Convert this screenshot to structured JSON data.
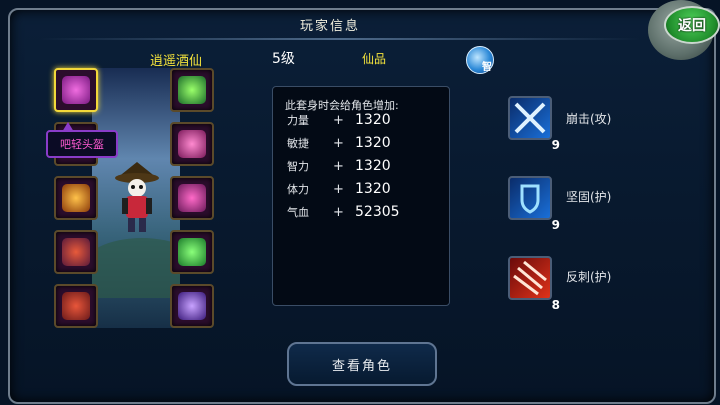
{
  "title": "玩家信息",
  "return_label": "返回",
  "character": {
    "name": "逍遥酒仙",
    "level": "5级",
    "rank": "仙品",
    "badge": "智"
  },
  "equipment_tooltip": "吧轻头盔",
  "equipment_slots_left": [
    {
      "icon": "helmet-icon",
      "color": "#b23ab5",
      "selected": true
    },
    {
      "icon": "necklace-icon",
      "color": "#6f2a7c",
      "selected": false
    },
    {
      "icon": "weapon-icon",
      "color": "#c9731a",
      "selected": false
    },
    {
      "icon": "armor-icon",
      "color": "#c73030",
      "selected": false
    },
    {
      "icon": "boots-icon",
      "color": "#c0321e",
      "selected": false
    }
  ],
  "equipment_slots_right": [
    {
      "icon": "amulet-icon",
      "color": "#2e8a3b",
      "selected": false
    },
    {
      "icon": "ring-icon",
      "color": "#d0398f",
      "selected": false
    },
    {
      "icon": "cape-icon",
      "color": "#c23aa0",
      "selected": false
    },
    {
      "icon": "gourd-icon",
      "color": "#3fc04a",
      "selected": false
    },
    {
      "icon": "staff-icon",
      "color": "#7a5ad6",
      "selected": false
    }
  ],
  "stats": {
    "heading": "此套身时会给角色增加:",
    "rows": [
      {
        "label": "力量",
        "sign": "+",
        "value": "1320"
      },
      {
        "label": "敏捷",
        "sign": "+",
        "value": "1320"
      },
      {
        "label": "智力",
        "sign": "+",
        "value": "1320"
      },
      {
        "label": "体力",
        "sign": "+",
        "value": "1320"
      },
      {
        "label": "气血",
        "sign": "+",
        "value": "52305"
      }
    ]
  },
  "skills": [
    {
      "icon": "crossed-swords-icon",
      "name": "崩击(攻)",
      "level": "9",
      "color": "#1a6fd8"
    },
    {
      "icon": "shield-icon",
      "name": "坚固(护)",
      "level": "9",
      "color": "#1a6fd8"
    },
    {
      "icon": "reflect-spikes-icon",
      "name": "反刺(护)",
      "level": "8",
      "color": "#d8291a"
    }
  ],
  "view_button_label": "查看角色"
}
